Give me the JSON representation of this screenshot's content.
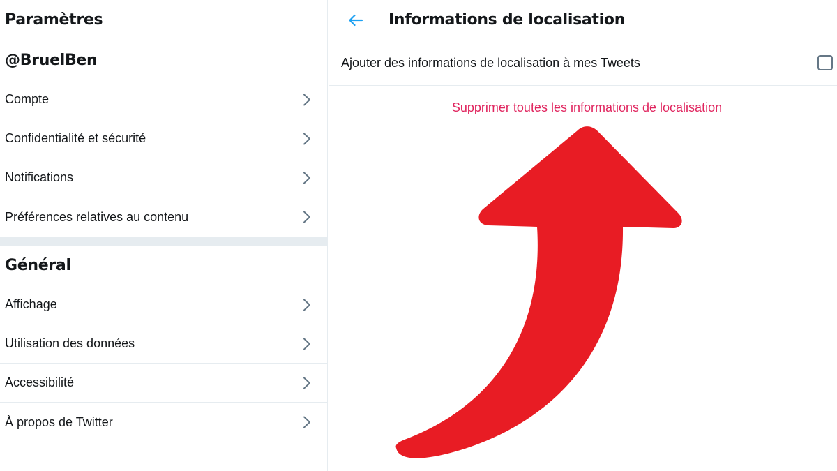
{
  "sidebar": {
    "title": "Paramètres",
    "account_section": "@BruelBen",
    "account_items": [
      {
        "label": "Compte"
      },
      {
        "label": "Confidentialité et sécurité"
      },
      {
        "label": "Notifications"
      },
      {
        "label": "Préférences relatives au contenu"
      }
    ],
    "general_section": "Général",
    "general_items": [
      {
        "label": "Affichage"
      },
      {
        "label": "Utilisation des données"
      },
      {
        "label": "Accessibilité"
      },
      {
        "label": "À propos de Twitter"
      }
    ]
  },
  "content": {
    "title": "Informations de localisation",
    "back_icon": "arrow-left-icon",
    "option_label": "Ajouter des informations de localisation à mes Tweets",
    "option_checked": false,
    "delete_link": "Supprimer toutes les informations de localisation"
  },
  "colors": {
    "accent": "#1da1f2",
    "danger_link": "#e0245e",
    "annotation_arrow": "#e81c24",
    "divider": "#e6ecf0"
  }
}
